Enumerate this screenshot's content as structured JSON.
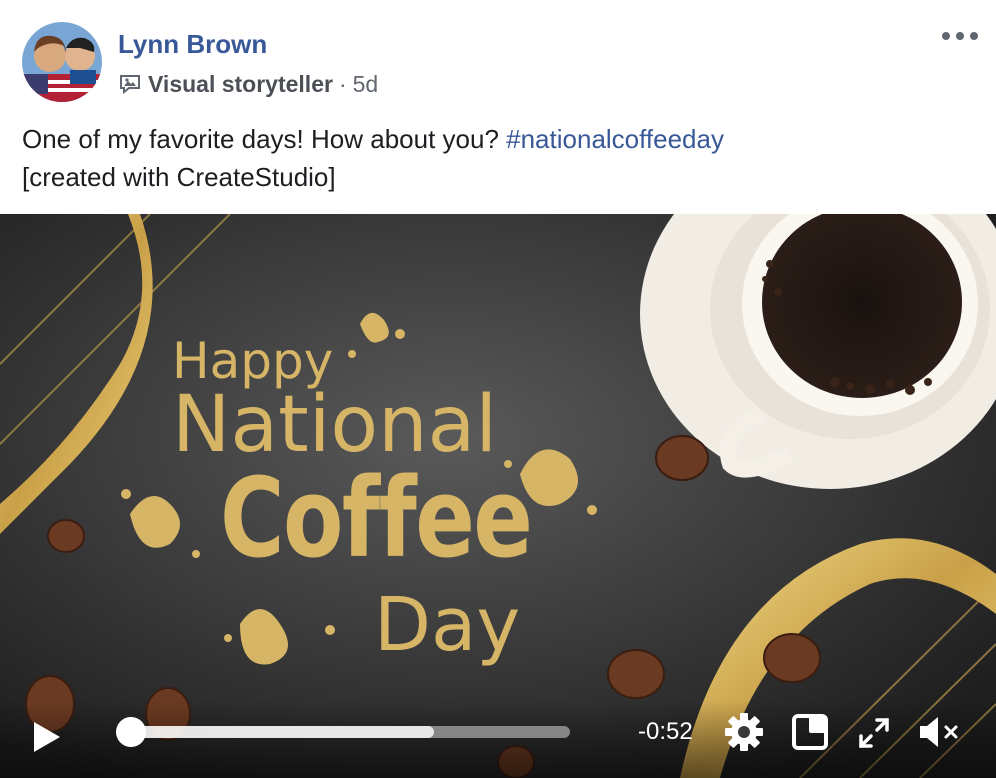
{
  "post": {
    "author": "Lynn Brown",
    "badge": "Visual storyteller",
    "separator": "·",
    "age": "5d",
    "text_main": "One of my favorite days! How about you? ",
    "hashtag": "#nationalcoffeeday",
    "text_line2": "[created with CreateStudio]"
  },
  "video": {
    "greeting_line1": "Happy",
    "greeting_line2": "National",
    "greeting_line3": "Coffee",
    "greeting_line4": "Day",
    "time_remaining": "-0:52",
    "progress": 0.0,
    "buffered": 0.69
  },
  "icons": {
    "more": "more-options-icon",
    "badge": "visual-storyteller-badge-icon",
    "play": "play-icon",
    "settings": "gear-icon",
    "pip": "picture-in-picture-icon",
    "fullscreen": "fullscreen-icon",
    "mute": "mute-icon"
  },
  "colors": {
    "link": "#385898",
    "gold": "#d6b567",
    "text": "#1c1e21"
  }
}
